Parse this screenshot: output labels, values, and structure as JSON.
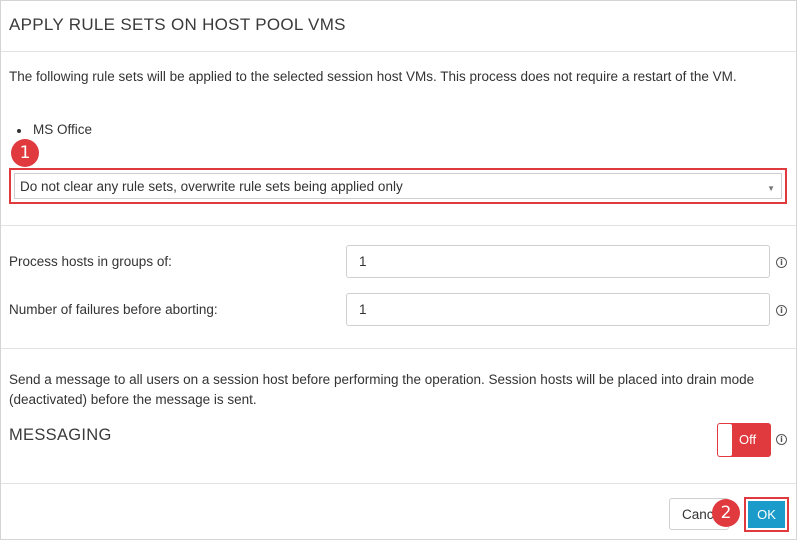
{
  "dialog": {
    "title": "APPLY RULE SETS ON HOST POOL VMS",
    "description": "The following rule sets will be applied to the selected session host VMs. This process does not require a restart of the VM.",
    "rule_sets": [
      "MS Office"
    ],
    "mode_select": {
      "selected": "Do not clear any rule sets, overwrite rule sets being applied only"
    },
    "fields": {
      "group_size_label": "Process hosts in groups of:",
      "group_size_value": "1",
      "failures_label": "Number of failures before aborting:",
      "failures_value": "1"
    },
    "messaging": {
      "description": "Send a message to all users on a session host before performing the operation. Session hosts will be placed into drain mode (deactivated) before the message is sent.",
      "title": "MESSAGING",
      "toggle_label": "Off"
    },
    "buttons": {
      "cancel": "Cancel",
      "ok": "OK"
    },
    "annotations": {
      "step1": "1",
      "step2": "2"
    }
  }
}
